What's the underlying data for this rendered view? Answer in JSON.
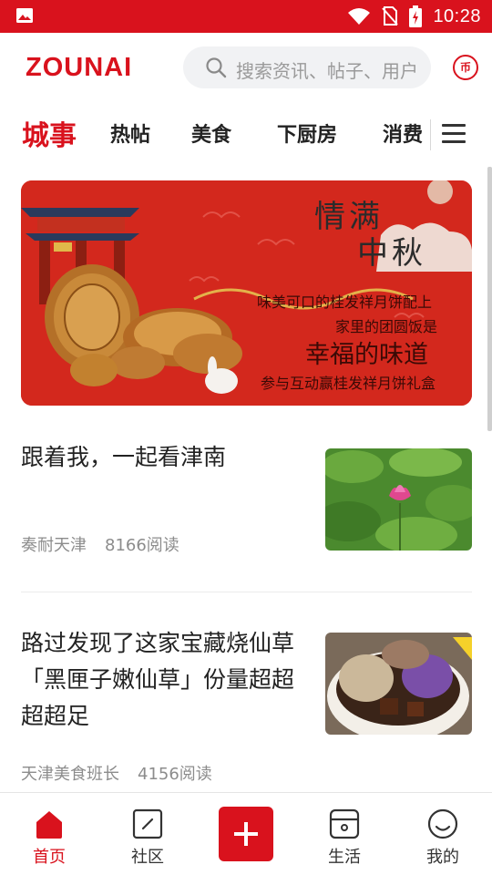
{
  "status_bar": {
    "time": "10:28"
  },
  "header": {
    "logo": "ZOUNAI",
    "search_placeholder": "搜索资讯、帖子、用户",
    "coin_label": "币"
  },
  "tabs": [
    "城事",
    "热帖",
    "美食",
    "下厨房",
    "消费"
  ],
  "active_tab": "城事",
  "banner": {
    "title_line1": "情满",
    "title_line2": "中秋",
    "line1": "味美可口的桂发祥月饼配上",
    "line2": "家里的团圆饭是",
    "line3": "幸福的味道",
    "line4": "参与互动赢桂发祥月饼礼盒"
  },
  "articles": [
    {
      "title": "跟着我，一起看津南",
      "author": "奏耐天津",
      "reads": "8166阅读",
      "thumb": "lotus-pond"
    },
    {
      "title": "路过发现了这家宝藏烧仙草「黑匣子嫩仙草」份量超超超超足",
      "author": "天津美食班长",
      "reads": "4156阅读",
      "thumb": "grass-jelly-bowl"
    }
  ],
  "bottom_nav": [
    {
      "label": "首页",
      "icon": "home-icon",
      "active": true
    },
    {
      "label": "社区",
      "icon": "community-icon",
      "active": false
    },
    {
      "label": "",
      "icon": "plus-icon",
      "active": false
    },
    {
      "label": "生活",
      "icon": "life-icon",
      "active": false
    },
    {
      "label": "我的",
      "icon": "profile-icon",
      "active": false
    }
  ],
  "colors": {
    "brand_red": "#d9121d",
    "text_dark": "#222222",
    "text_meta": "#8c8c8c"
  }
}
